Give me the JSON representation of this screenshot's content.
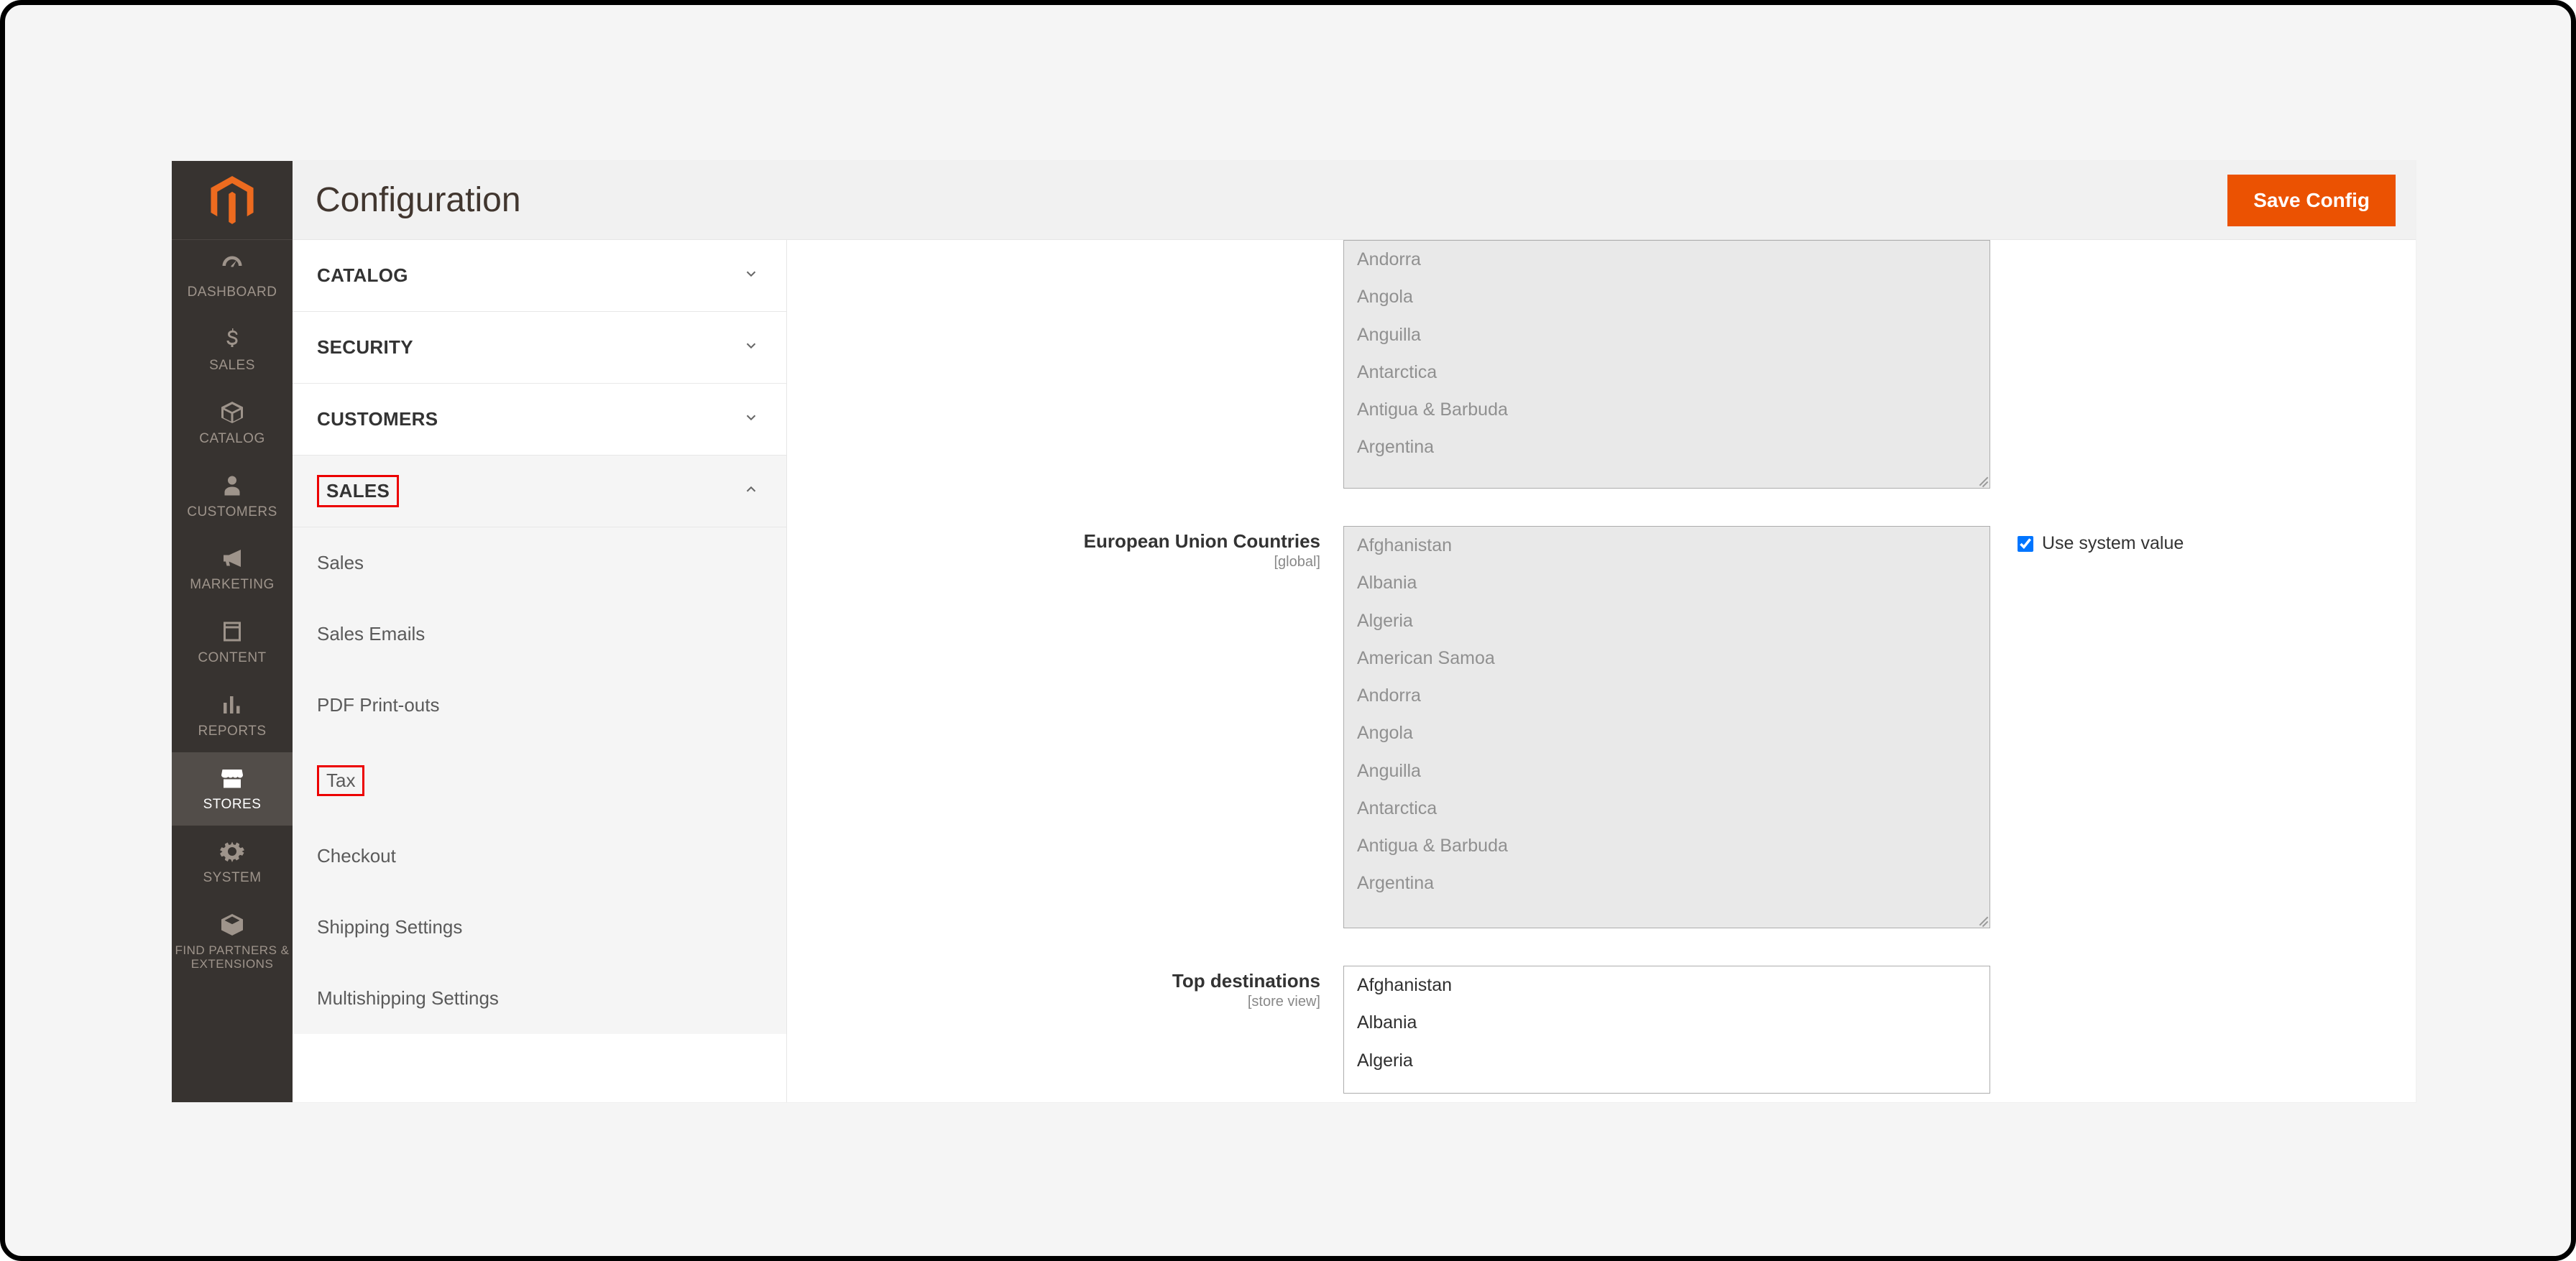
{
  "page_title": "Configuration",
  "save_button_label": "Save Config",
  "sidebar": {
    "items": [
      {
        "label": "DASHBOARD"
      },
      {
        "label": "SALES"
      },
      {
        "label": "CATALOG"
      },
      {
        "label": "CUSTOMERS"
      },
      {
        "label": "MARKETING"
      },
      {
        "label": "CONTENT"
      },
      {
        "label": "REPORTS"
      },
      {
        "label": "STORES"
      },
      {
        "label": "SYSTEM"
      },
      {
        "label": "FIND PARTNERS & EXTENSIONS"
      }
    ]
  },
  "config_nav": {
    "sections": [
      {
        "label": "CATALOG",
        "expanded": false
      },
      {
        "label": "SECURITY",
        "expanded": false
      },
      {
        "label": "CUSTOMERS",
        "expanded": false
      },
      {
        "label": "SALES",
        "expanded": true,
        "highlight": true
      }
    ],
    "sales_subitems": [
      {
        "label": "Sales"
      },
      {
        "label": "Sales Emails"
      },
      {
        "label": "PDF Print-outs"
      },
      {
        "label": "Tax",
        "highlight": true
      },
      {
        "label": "Checkout"
      },
      {
        "label": "Shipping Settings"
      },
      {
        "label": "Multishipping Settings"
      }
    ]
  },
  "fields": {
    "first_list": {
      "options": [
        "Andorra",
        "Angola",
        "Anguilla",
        "Antarctica",
        "Antigua & Barbuda",
        "Argentina"
      ]
    },
    "eu_countries": {
      "label": "European Union Countries",
      "scope": "[global]",
      "use_system_value_label": "Use system value",
      "use_system_value_checked": true,
      "options": [
        "Afghanistan",
        "Albania",
        "Algeria",
        "American Samoa",
        "Andorra",
        "Angola",
        "Anguilla",
        "Antarctica",
        "Antigua & Barbuda",
        "Argentina"
      ]
    },
    "top_destinations": {
      "label": "Top destinations",
      "scope": "[store view]",
      "options": [
        "Afghanistan",
        "Albania",
        "Algeria"
      ]
    }
  }
}
